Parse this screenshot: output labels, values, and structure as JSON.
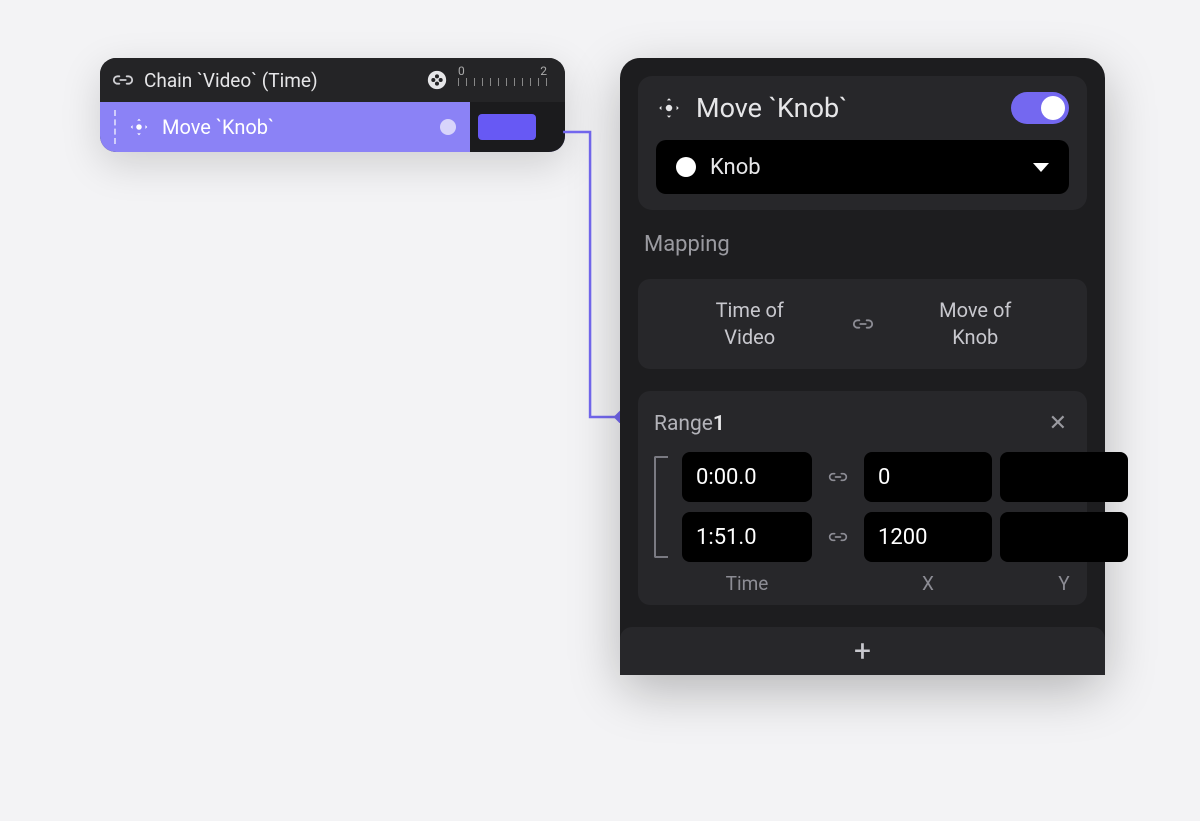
{
  "chain": {
    "title": "Chain `Video` (Time)",
    "row_label": "Move `Knob`",
    "timeline_ticks": {
      "start": "0",
      "end": "2"
    }
  },
  "panel": {
    "title": "Move `Knob`",
    "enabled": true,
    "dropdown": {
      "selected": "Knob"
    },
    "mapping": {
      "section_label": "Mapping",
      "from_line1": "Time of",
      "from_line2": "Video",
      "to_line1": "Move of",
      "to_line2": "Knob"
    },
    "range": {
      "label_prefix": "Range",
      "label_num": "1",
      "rows": [
        {
          "time": "0:00.0",
          "x": "0",
          "y": ""
        },
        {
          "time": "1:51.0",
          "x": "1200",
          "y": ""
        }
      ],
      "col_labels": {
        "time": "Time",
        "x": "X",
        "y": "Y"
      }
    },
    "add_label": "+"
  }
}
